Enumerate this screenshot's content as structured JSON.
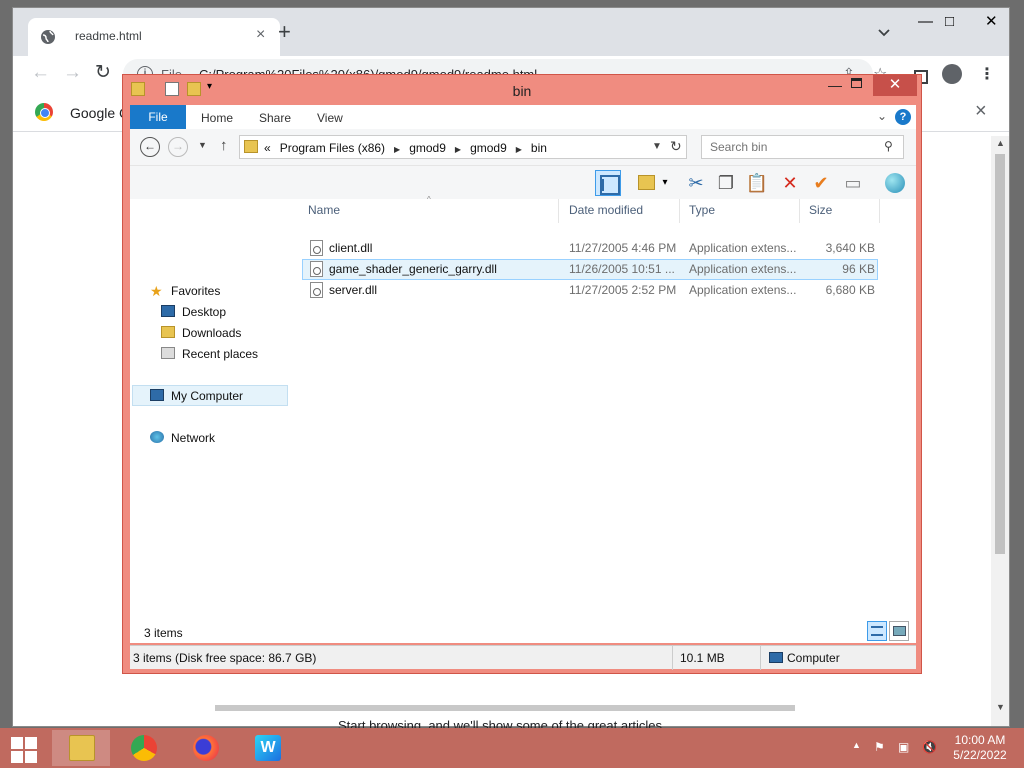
{
  "browser": {
    "tab_title": "readme.html",
    "tab_close": "×",
    "new_tab": "+",
    "window_minimize": "—",
    "window_maximize": "□",
    "window_close": "✕",
    "back": "←",
    "forward": "→",
    "reload": "↻",
    "scheme": "File",
    "url": "C:/Program%20Files%20(x86)/gmod9/gmod9/readme.html",
    "infobar_text": "Google C",
    "infobar_close": "×",
    "page_text": "Start browsing, and we'll show some of the great articles"
  },
  "explorer": {
    "title": "bin",
    "minimize": "—",
    "close": "✕",
    "ribbon": {
      "file": "File",
      "home": "Home",
      "share": "Share",
      "view": "View",
      "help": "?"
    },
    "address": {
      "overflow": "«",
      "crumbs": [
        "Program Files (x86)",
        "gmod9",
        "gmod9",
        "bin"
      ]
    },
    "search_placeholder": "Search bin",
    "nav": {
      "favorites": "Favorites",
      "desktop": "Desktop",
      "downloads": "Downloads",
      "recent": "Recent places",
      "computer": "My Computer",
      "network": "Network"
    },
    "columns": {
      "name": "Name",
      "date": "Date modified",
      "type": "Type",
      "size": "Size"
    },
    "files": [
      {
        "name": "client.dll",
        "date": "11/27/2005 4:46 PM",
        "type": "Application extens...",
        "size": "3,640 KB"
      },
      {
        "name": "game_shader_generic_garry.dll",
        "date": "11/26/2005 10:51 ...",
        "type": "Application extens...",
        "size": "96 KB"
      },
      {
        "name": "server.dll",
        "date": "11/27/2005 2:52 PM",
        "type": "Application extens...",
        "size": "6,680 KB"
      }
    ],
    "item_count": "3 items",
    "status": {
      "summary": "3 items (Disk free space: 86.7 GB)",
      "size": "10.1 MB",
      "location": "Computer"
    }
  },
  "taskbar": {
    "time": "10:00 AM",
    "date": "5/22/2022"
  }
}
